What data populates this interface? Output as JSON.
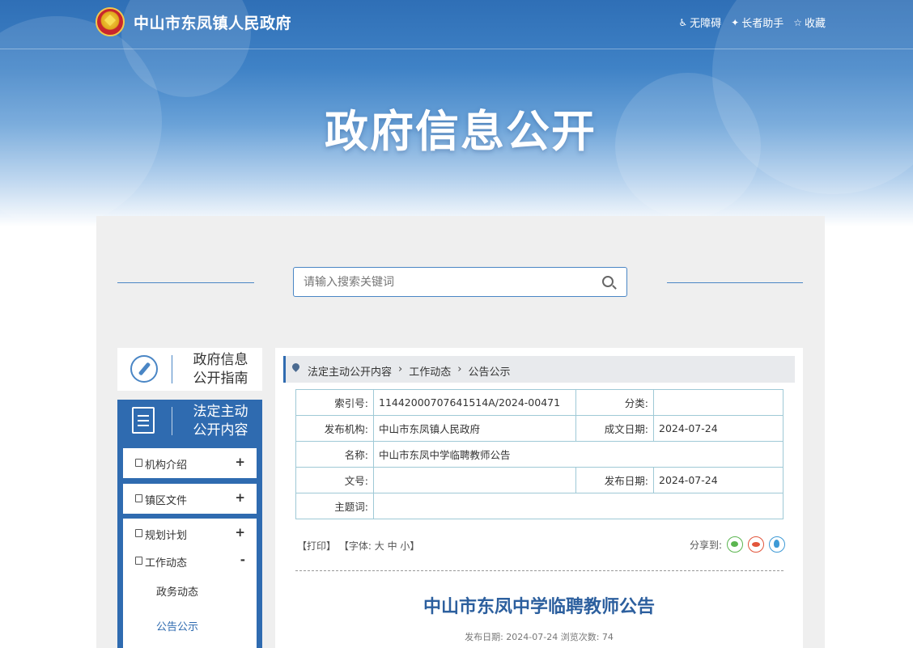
{
  "header": {
    "site_title": "中山市东凤镇人民政府",
    "tools": [
      {
        "icon": "accessibility-icon",
        "label": "无障碍"
      },
      {
        "icon": "elderly-helper-icon",
        "label": "长者助手"
      },
      {
        "icon": "star-icon",
        "label": "收藏"
      }
    ]
  },
  "banner": {
    "title": "政府信息公开"
  },
  "search": {
    "placeholder": "请输入搜索关键词"
  },
  "sidebar": {
    "guide": "政府信息公开指南",
    "guide_line1": "政府信息",
    "guide_line2": "公开指南",
    "legal_line1": "法定主动",
    "legal_line2": "公开内容",
    "menu": [
      {
        "label": "机构介绍",
        "toggle": "+"
      },
      {
        "label": "镇区文件",
        "toggle": "+"
      },
      {
        "label": "规划计划",
        "toggle": "+"
      },
      {
        "label": "工作动态",
        "toggle": "-"
      }
    ],
    "submenu": [
      {
        "label": "政务动态"
      },
      {
        "label": "公告公示"
      }
    ]
  },
  "breadcrumb": [
    "法定主动公开内容",
    "工作动态",
    "公告公示"
  ],
  "meta": {
    "index_label": "索引号:",
    "index_value": "11442000707641514A/2024-00471",
    "category_label": "分类:",
    "category_value": "",
    "publisher_label": "发布机构:",
    "publisher_value": "中山市东凤镇人民政府",
    "created_label": "成文日期:",
    "created_value": "2024-07-24",
    "name_label": "名称:",
    "name_value": "中山市东凤中学临聘教师公告",
    "docno_label": "文号:",
    "docno_value": "",
    "pubdate_label": "发布日期:",
    "pubdate_value": "2024-07-24",
    "keywords_label": "主题词:",
    "keywords_value": ""
  },
  "tools_row": {
    "print": "【打印】",
    "font_prefix": "【字体:",
    "font_big": "大",
    "font_mid": "中",
    "font_small": "小】",
    "share_label": "分享到:"
  },
  "article": {
    "title": "中山市东凤中学临聘教师公告",
    "meta": "发布日期: 2024-07-24  浏览次数: 74"
  },
  "colors": {
    "accent": "#2f6bb0",
    "title_blue": "#2c5f9e",
    "border_teal": "#9fc9d6"
  }
}
